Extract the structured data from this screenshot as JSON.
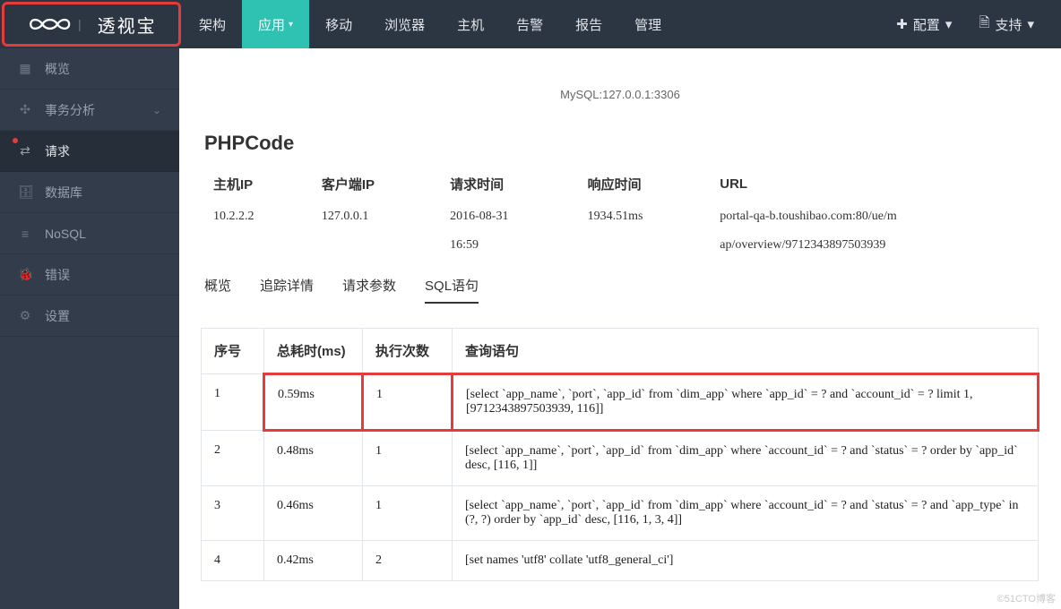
{
  "brand": {
    "name": "透视宝"
  },
  "topnav": {
    "items": [
      {
        "label": "架构",
        "active": false
      },
      {
        "label": "应用",
        "active": true,
        "caret": true
      },
      {
        "label": "移动",
        "active": false
      },
      {
        "label": "浏览器",
        "active": false
      },
      {
        "label": "主机",
        "active": false
      },
      {
        "label": "告警",
        "active": false
      },
      {
        "label": "报告",
        "active": false
      },
      {
        "label": "管理",
        "active": false
      }
    ],
    "right": [
      {
        "icon": "plus-icon",
        "label": "配置",
        "caret": true
      },
      {
        "icon": "doc-icon",
        "label": "支持",
        "caret": true
      }
    ]
  },
  "sidebar": {
    "items": [
      {
        "icon": "grid-icon",
        "label": "概览"
      },
      {
        "icon": "transaction-icon",
        "label": "事务分析",
        "caret": true
      },
      {
        "icon": "request-icon",
        "label": "请求",
        "active": true,
        "dot": true
      },
      {
        "icon": "database-icon",
        "label": "数据库"
      },
      {
        "icon": "list-icon",
        "label": "NoSQL"
      },
      {
        "icon": "bug-icon",
        "label": "错误"
      },
      {
        "icon": "gear-icon",
        "label": "设置"
      }
    ]
  },
  "main": {
    "mysql_label": "MySQL:127.0.0.1:3306",
    "section_title": "PHPCode",
    "info_headers": {
      "host_ip": "主机IP",
      "client_ip": "客户端IP",
      "request_time": "请求时间",
      "response_time": "响应时间",
      "url": "URL"
    },
    "info": {
      "host_ip": "10.2.2.2",
      "client_ip": "127.0.0.1",
      "request_time_1": "2016-08-31",
      "request_time_2": "16:59",
      "response_time": "1934.51ms",
      "url_1": "portal-qa-b.toushibao.com:80/ue/m",
      "url_2": "ap/overview/9712343897503939"
    },
    "tabs": [
      {
        "label": "概览"
      },
      {
        "label": "追踪详情"
      },
      {
        "label": "请求参数"
      },
      {
        "label": "SQL语句",
        "active": true
      }
    ],
    "sql_headers": {
      "seq": "序号",
      "time": "总耗时(ms)",
      "count": "执行次数",
      "query": "查询语句"
    },
    "sql_rows": [
      {
        "seq": "1",
        "time": "0.59ms",
        "count": "1",
        "query": "[select `app_name`, `port`, `app_id` from `dim_app` where `app_id` = ? and `account_id` = ? limit 1, [9712343897503939, 116]]",
        "highlight": true
      },
      {
        "seq": "2",
        "time": "0.48ms",
        "count": "1",
        "query": "[select `app_name`, `port`, `app_id` from `dim_app` where `account_id` = ? and `status` = ? order by `app_id` desc, [116, 1]]"
      },
      {
        "seq": "3",
        "time": "0.46ms",
        "count": "1",
        "query": "[select `app_name`, `port`, `app_id` from `dim_app` where `account_id` = ? and `status` = ? and `app_type` in (?, ?) order by `app_id` desc, [116, 1, 3, 4]]"
      },
      {
        "seq": "4",
        "time": "0.42ms",
        "count": "2",
        "query": "[set names 'utf8' collate 'utf8_general_ci']"
      }
    ]
  },
  "watermark": "©51CTO博客"
}
